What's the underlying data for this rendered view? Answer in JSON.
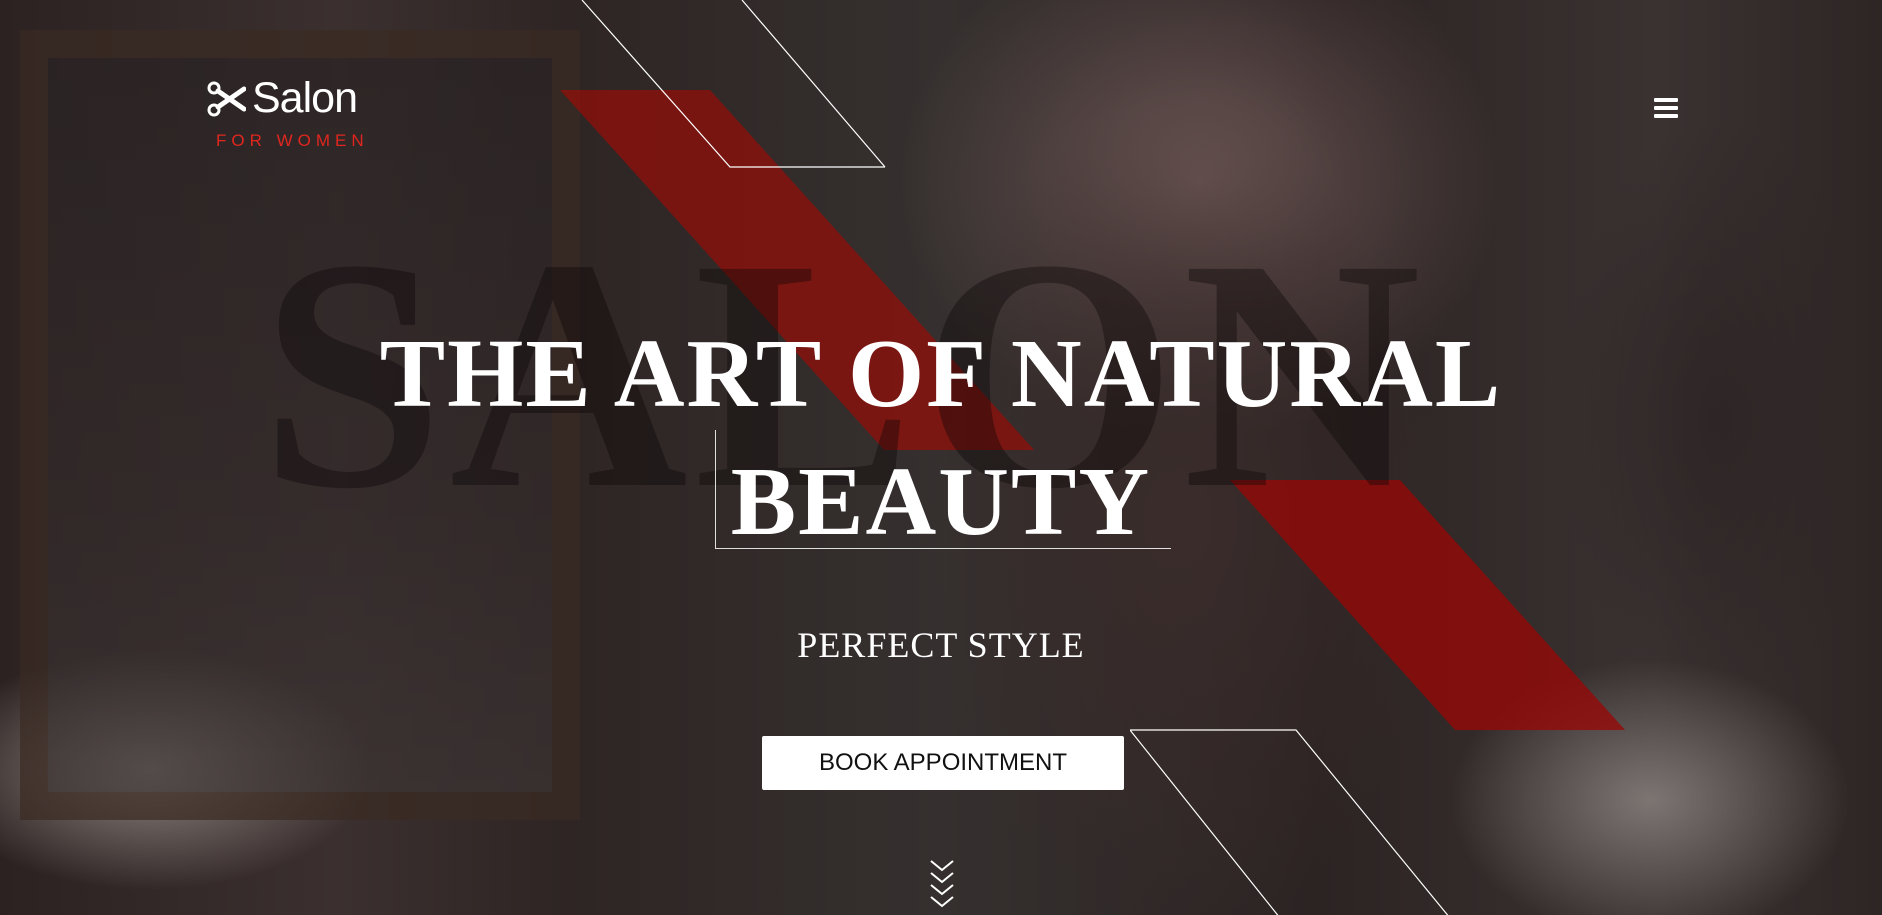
{
  "logo": {
    "icon": "scissors-icon",
    "title": "Salon",
    "subtitle": "FOR WOMEN"
  },
  "nav": {
    "menu_icon": "hamburger-menu-icon"
  },
  "hero": {
    "watermark": "SALON",
    "headline_line1": "THE ART OF NATURAL",
    "headline_line2": "BEAUTY",
    "subtitle": "PERFECT STYLE",
    "cta_label": "BOOK APPOINTMENT",
    "scroll_icon": "chevrons-down-icon"
  },
  "colors": {
    "accent_red": "#e0261e",
    "text": "#ffffff",
    "button_bg": "#ffffff"
  }
}
